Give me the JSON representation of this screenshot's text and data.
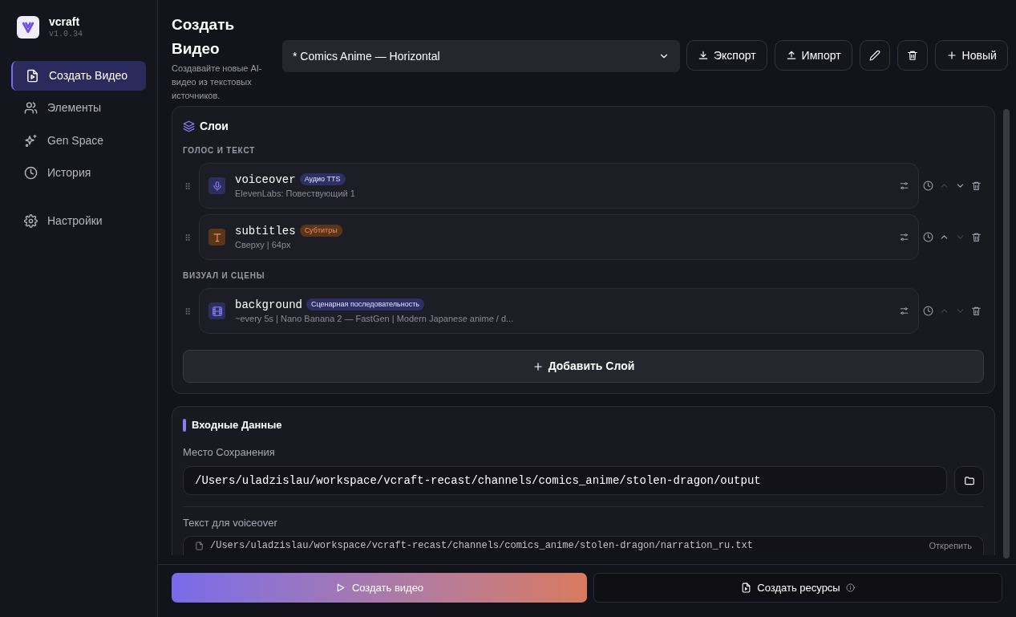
{
  "app": {
    "name": "vcraft",
    "version": "v1.0.34"
  },
  "sidebar": {
    "items": [
      {
        "label": "Создать Видео",
        "selected": true
      },
      {
        "label": "Элементы",
        "selected": false
      },
      {
        "label": "Gen Space",
        "selected": false
      },
      {
        "label": "История",
        "selected": false
      },
      {
        "label": "Настройки",
        "selected": false
      }
    ]
  },
  "header": {
    "title": "Создать Видео",
    "subtitle": "Создавайте новые AI-видео из текстовых источников.",
    "preset": "* Comics Anime — Horizontal",
    "buttons": [
      {
        "kind": "export",
        "label": "Экспорт"
      },
      {
        "kind": "import",
        "label": "Импорт"
      },
      {
        "kind": "edit"
      },
      {
        "kind": "delete"
      },
      {
        "kind": "new",
        "label": "Новый"
      }
    ]
  },
  "layers": {
    "title": "Слои",
    "groups": [
      {
        "title": "ГОЛОС И ТЕКСТ",
        "items": [
          {
            "kind": "voice",
            "name": "voiceover",
            "badge": "Аудио TTS",
            "color": "#2f2f66",
            "detail": "ElevenLabs: Повествующий 1",
            "up_disabled": true,
            "down_disabled": false
          },
          {
            "kind": "text",
            "name": "subtitles",
            "badge": "Субтитры",
            "color": "#5a3619",
            "detail": "Сверху | 64px",
            "up_disabled": false,
            "down_disabled": true
          }
        ]
      },
      {
        "title": "ВИЗУАЛ И СЦЕНЫ",
        "items": [
          {
            "kind": "film",
            "name": "background",
            "badge": "Сценарная последовательность",
            "color": "#2f2f66",
            "detail": "~every 5s | Nano Banana 2 — FastGen | Modern Japanese anime / d...",
            "up_disabled": true,
            "down_disabled": true
          }
        ]
      }
    ],
    "add_label": "Добавить Слой"
  },
  "inputs": {
    "title": "Входные Данные",
    "save_label": "Место Сохранения",
    "save_path": "/Users/uladzislau/workspace/vcraft-recast/channels/comics_anime/stolen-dragon/output",
    "text_label": "Текст для voiceover",
    "text_file": "/Users/uladzislau/workspace/vcraft-recast/channels/comics_anime/stolen-dragon/narration_ru.txt",
    "detach": "Открепить"
  },
  "footer": {
    "create": "Создать видео",
    "resources": "Создать ресурсы"
  }
}
